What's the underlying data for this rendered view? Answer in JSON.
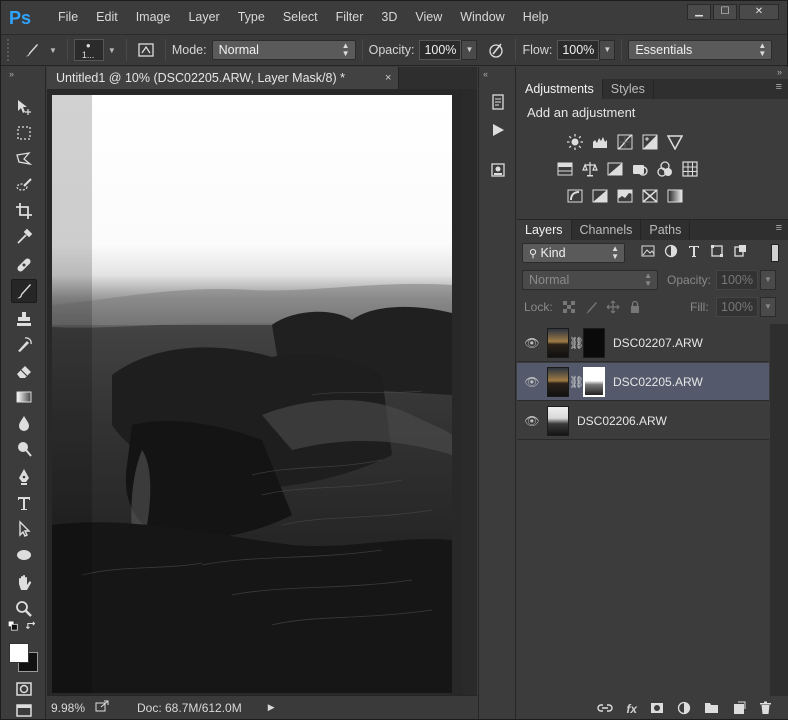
{
  "app": {
    "logo": "Ps"
  },
  "menu": [
    "File",
    "Edit",
    "Image",
    "Layer",
    "Type",
    "Select",
    "Filter",
    "3D",
    "View",
    "Window",
    "Help"
  ],
  "window_controls": {
    "minimize": "▁",
    "maximize": "☐",
    "close": "✕"
  },
  "options": {
    "brush_size": "1...",
    "mode_label": "Mode:",
    "mode_value": "Normal",
    "opacity_label": "Opacity:",
    "opacity_value": "100%",
    "flow_label": "Flow:",
    "flow_value": "100%",
    "workspace": "Essentials"
  },
  "document": {
    "tab_title": "Untitled1 @ 10% (DSC02205.ARW, Layer Mask/8) *",
    "close_glyph": "×",
    "zoom": "9.98%",
    "doc_size": "Doc: 68.7M/612.0M"
  },
  "adjustments": {
    "tabs": [
      "Adjustments",
      "Styles"
    ],
    "title": "Add an adjustment"
  },
  "layers": {
    "tabs": [
      "Layers",
      "Channels",
      "Paths"
    ],
    "filter_label": "Kind",
    "blend_mode": "Normal",
    "opacity_label": "Opacity:",
    "opacity_value": "100%",
    "lock_label": "Lock:",
    "fill_label": "Fill:",
    "fill_value": "100%",
    "items": [
      {
        "name": "DSC02207.ARW",
        "has_mask": true,
        "mask": "dark",
        "selected": false
      },
      {
        "name": "DSC02205.ARW",
        "has_mask": true,
        "mask": "light",
        "selected": true
      },
      {
        "name": "DSC02206.ARW",
        "has_mask": false,
        "selected": false
      }
    ],
    "footer_icons": [
      "link-icon",
      "fx-icon",
      "mask-icon",
      "adjustment-icon",
      "folder-icon",
      "new-layer-icon",
      "trash-icon"
    ],
    "footer_fx": "fx"
  },
  "colors": {
    "accent": "#2fa4ff",
    "selected_layer": "#545a6c",
    "panel_bg": "#3c3c3c"
  }
}
